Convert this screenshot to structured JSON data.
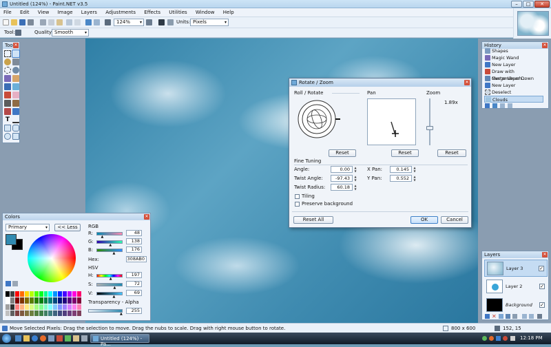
{
  "window": {
    "title": "Untitled (124%) - Paint.NET v3.5"
  },
  "menu": [
    "File",
    "Edit",
    "View",
    "Image",
    "Layers",
    "Adjustments",
    "Effects",
    "Utilities",
    "Window",
    "Help"
  ],
  "toolbar": {
    "zoom_value": "124%",
    "units_label": "Units:",
    "units_value": "Pixels",
    "tool_label": "Tool:",
    "quality_label": "Quality:",
    "quality_value": "Smooth"
  },
  "tools_panel": {
    "title": "Tools"
  },
  "history_panel": {
    "title": "History",
    "items": [
      "Shapes",
      "Magic Wand",
      "New Layer",
      "Draw with CustomBrush...",
      "Merge Layer Down",
      "New Layer",
      "Deselect",
      "Clouds"
    ],
    "selected_index": 7
  },
  "dialog": {
    "title": "Rotate / Zoom",
    "roll_rotate_label": "Roll / Rotate",
    "pan_label": "Pan",
    "zoom_label": "Zoom",
    "zoom_value": "1.89x",
    "zoom_level": 0.35,
    "reset_label": "Reset",
    "fine_tuning_label": "Fine Tuning",
    "fields": {
      "angle_label": "Angle:",
      "angle_value": "0.00",
      "twist_angle_label": "Twist Angle:",
      "twist_angle_value": "-97.43",
      "twist_radius_label": "Twist Radius:",
      "twist_radius_value": "60.18",
      "x_pan_label": "X Pan:",
      "x_pan_value": "0.145",
      "y_pan_label": "Y Pan:",
      "y_pan_value": "0.552"
    },
    "tiling_label": "Tiling",
    "preserve_label": "Preserve background",
    "reset_all_label": "Reset All",
    "ok_label": "OK",
    "cancel_label": "Cancel"
  },
  "colors_panel": {
    "title": "Colors",
    "mode_value": "Primary",
    "less_label": "<< Less",
    "rgb_label": "RGB",
    "r_label": "R:",
    "r_value": "48",
    "r_level": 0.19,
    "g_label": "G:",
    "g_value": "138",
    "g_level": 0.54,
    "b_label": "B:",
    "b_value": "176",
    "b_level": 0.69,
    "hex_label": "Hex:",
    "hex_value": "308AB0",
    "hsv_label": "HSV",
    "h_label": "H:",
    "h_value": "197",
    "h_level": 0.55,
    "s_label": "S:",
    "s_value": "72",
    "s_level": 0.72,
    "v_label": "V:",
    "v_value": "69",
    "v_level": 0.69,
    "transparency_label": "Transparency - Alpha",
    "alpha_value": "255",
    "alpha_level": 1.0,
    "primary_color": "#308AB0",
    "secondary_color": "#000000"
  },
  "layers_panel": {
    "title": "Layers",
    "layers": [
      {
        "name": "Layer 3",
        "visible": "✓"
      },
      {
        "name": "Layer 2",
        "visible": "✓"
      },
      {
        "name": "Background",
        "visible": "✓"
      }
    ]
  },
  "statusbar": {
    "message": "Move Selected Pixels: Drag the selection to move. Drag the nubs to scale. Drag with right mouse button to rotate.",
    "image_size": "800 x 600",
    "cursor_pos": "152, 15"
  },
  "taskbar": {
    "task_label": "Untitled (124%) - Pa...",
    "clock": "12:18 PM"
  }
}
